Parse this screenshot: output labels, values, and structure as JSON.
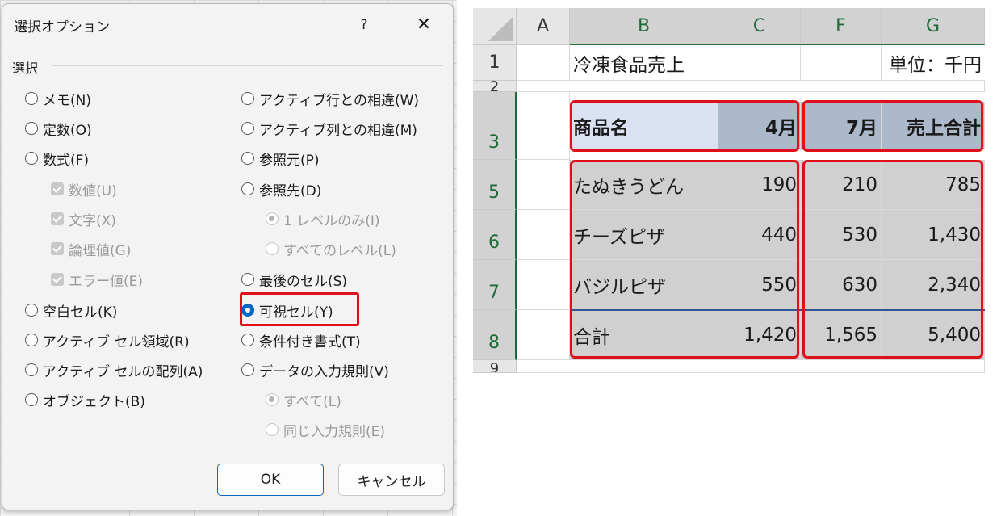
{
  "dialog": {
    "title": "選択オプション",
    "help": "?",
    "close": "✕",
    "group_label": "選択",
    "left_options": [
      {
        "label": "メモ(N)"
      },
      {
        "label": "定数(O)"
      },
      {
        "label": "数式(F)"
      },
      {
        "label": "数値(U)"
      },
      {
        "label": "文字(X)"
      },
      {
        "label": "論理値(G)"
      },
      {
        "label": "エラー値(E)"
      },
      {
        "label": "空白セル(K)"
      },
      {
        "label": "アクティブ セル領域(R)"
      },
      {
        "label": "アクティブ セルの配列(A)"
      },
      {
        "label": "オブジェクト(B)"
      }
    ],
    "right_options": [
      {
        "label": "アクティブ行との相違(W)"
      },
      {
        "label": "アクティブ列との相違(M)"
      },
      {
        "label": "参照元(P)"
      },
      {
        "label": "参照先(D)"
      },
      {
        "label": "1 レベルのみ(I)"
      },
      {
        "label": "すべてのレベル(L)"
      },
      {
        "label": "最後のセル(S)"
      },
      {
        "label": "可視セル(Y)"
      },
      {
        "label": "条件付き書式(T)"
      },
      {
        "label": "データの入力規則(V)"
      },
      {
        "label": "すべて(L)"
      },
      {
        "label": "同じ入力規則(E)"
      }
    ],
    "selected_option": "可視セル(Y)",
    "ok_label": "OK",
    "cancel_label": "キャンセル",
    "colors": {
      "accent": "#0067c0",
      "highlight": "#e0101a"
    }
  },
  "sheet": {
    "columns": [
      "A",
      "B",
      "C",
      "F",
      "G"
    ],
    "rows": [
      "1",
      "2",
      "3",
      "5",
      "6",
      "7",
      "8",
      "9"
    ],
    "b1": "冷凍食品売上",
    "g1": "単位：千円",
    "header": {
      "name": "商品名",
      "c": "4月",
      "f": "7月",
      "g": "売上合計"
    },
    "data": [
      {
        "name": "たぬきうどん",
        "c": "190",
        "f": "210",
        "g": "785"
      },
      {
        "name": "チーズピザ",
        "c": "440",
        "f": "530",
        "g": "1,430"
      },
      {
        "name": "バジルピザ",
        "c": "550",
        "f": "630",
        "g": "2,340"
      },
      {
        "name": "合計",
        "c": "1,420",
        "f": "1,565",
        "g": "5,400"
      }
    ],
    "colors": {
      "selection": "#d0d0d0",
      "header_blue": "#d9e1f2",
      "header_gray": "#acb9ca",
      "highlight": "#e0101a"
    }
  }
}
